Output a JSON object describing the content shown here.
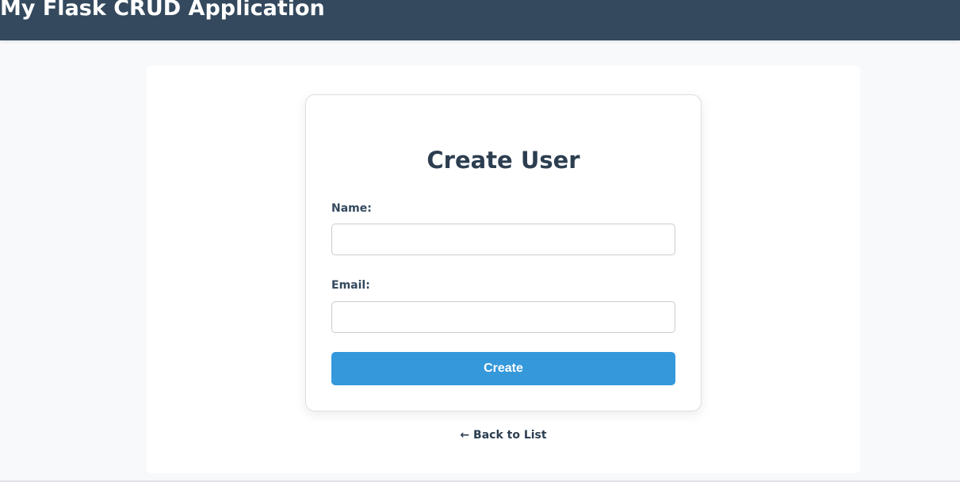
{
  "header": {
    "title": "My Flask CRUD Application"
  },
  "form": {
    "title": "Create User",
    "fields": [
      {
        "label": "Name:",
        "value": "",
        "placeholder": ""
      },
      {
        "label": "Email:",
        "value": "",
        "placeholder": ""
      }
    ],
    "submit_label": "Create"
  },
  "navigation": {
    "back_link": "← Back to List"
  },
  "colors": {
    "header_bg": "#34495e",
    "button_bg": "#3498db",
    "page_bg": "#f8f9fb",
    "text_dark": "#2c3e50"
  }
}
